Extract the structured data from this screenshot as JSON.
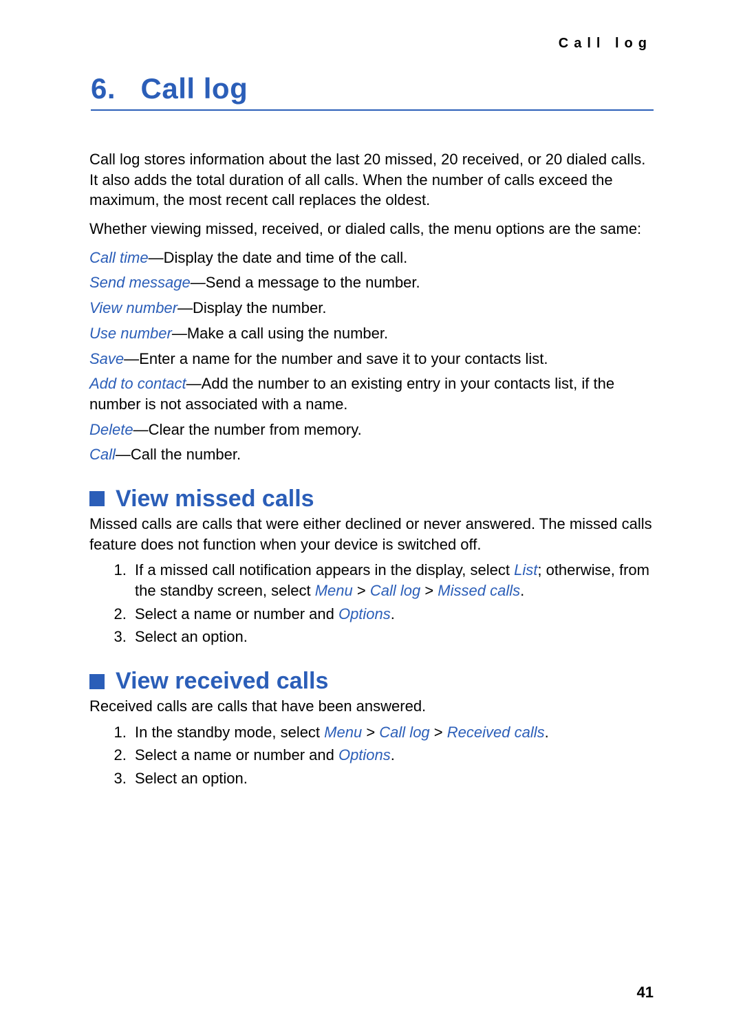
{
  "running_header": "Call log",
  "chapter": {
    "number": "6.",
    "title": "Call log"
  },
  "intro_paragraphs": [
    "Call log stores information about the last 20 missed, 20 received, or 20 dialed calls. It also adds the total duration of all calls. When the number of calls exceed the maximum, the most recent call replaces the oldest.",
    "Whether viewing missed, received, or dialed calls, the menu options are the same:"
  ],
  "options": [
    {
      "term": "Call time",
      "desc": "—Display the date and time of the call."
    },
    {
      "term": "Send message",
      "desc": "—Send a message to the number."
    },
    {
      "term": "View number",
      "desc": "—Display the number."
    },
    {
      "term": "Use number",
      "desc": "—Make a call using the number."
    },
    {
      "term": "Save",
      "desc": "—Enter a name for the number and save it to your contacts list."
    },
    {
      "term": "Add to contact",
      "desc": "—Add the number to an existing entry in your contacts list, if the number is not associated with a name."
    },
    {
      "term": "Delete",
      "desc": "—Clear the number from memory."
    },
    {
      "term": "Call",
      "desc": "—Call the number."
    }
  ],
  "sections": [
    {
      "heading": "View missed calls",
      "intro": "Missed calls are calls that were either declined or never answered. The missed calls feature does not function when your device is switched off.",
      "steps": [
        {
          "segments": [
            {
              "t": "If a missed call notification appears in the display, select "
            },
            {
              "m": "List"
            },
            {
              "t": "; otherwise, from the standby screen, select "
            },
            {
              "m": "Menu"
            },
            {
              "t": " > "
            },
            {
              "m": "Call log"
            },
            {
              "t": " > "
            },
            {
              "m": "Missed calls"
            },
            {
              "t": "."
            }
          ]
        },
        {
          "segments": [
            {
              "t": "Select a name or number and "
            },
            {
              "m": "Options"
            },
            {
              "t": "."
            }
          ]
        },
        {
          "segments": [
            {
              "t": "Select an option."
            }
          ]
        }
      ]
    },
    {
      "heading": "View received calls",
      "intro": "Received calls are calls that have been answered.",
      "steps": [
        {
          "segments": [
            {
              "t": "In the standby mode, select "
            },
            {
              "m": "Menu"
            },
            {
              "t": " > "
            },
            {
              "m": "Call log"
            },
            {
              "t": " > "
            },
            {
              "m": "Received calls"
            },
            {
              "t": "."
            }
          ]
        },
        {
          "segments": [
            {
              "t": "Select a name or number and "
            },
            {
              "m": "Options"
            },
            {
              "t": "."
            }
          ]
        },
        {
          "segments": [
            {
              "t": "Select an option."
            }
          ]
        }
      ]
    }
  ],
  "page_number": "41"
}
